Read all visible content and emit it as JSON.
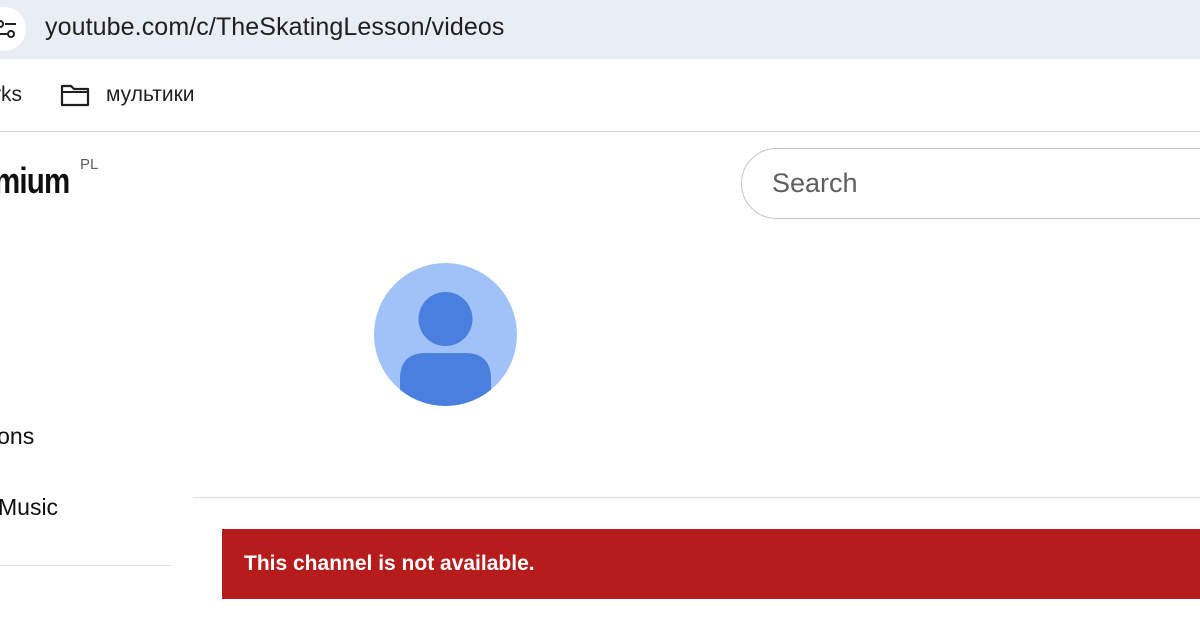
{
  "browser": {
    "url": "youtube.com/c/TheSkatingLesson/videos",
    "site_info_icon": "tune-icon"
  },
  "bookmarks_bar": {
    "partial_item": "rks",
    "folder": {
      "icon": "folder-icon",
      "label": "мультики"
    }
  },
  "header": {
    "logo_text": "mium",
    "country_code": "PL",
    "search_placeholder": "Search"
  },
  "channel": {
    "avatar_icon": "person-icon",
    "avatar_bg_color": "#a0c2f8",
    "avatar_fg_color": "#4a7fdf"
  },
  "sidebar": {
    "items": [
      {
        "label": "ions"
      },
      {
        "label": "Music"
      }
    ]
  },
  "error": {
    "message": "This channel is not available.",
    "color": "#b71c1c"
  }
}
